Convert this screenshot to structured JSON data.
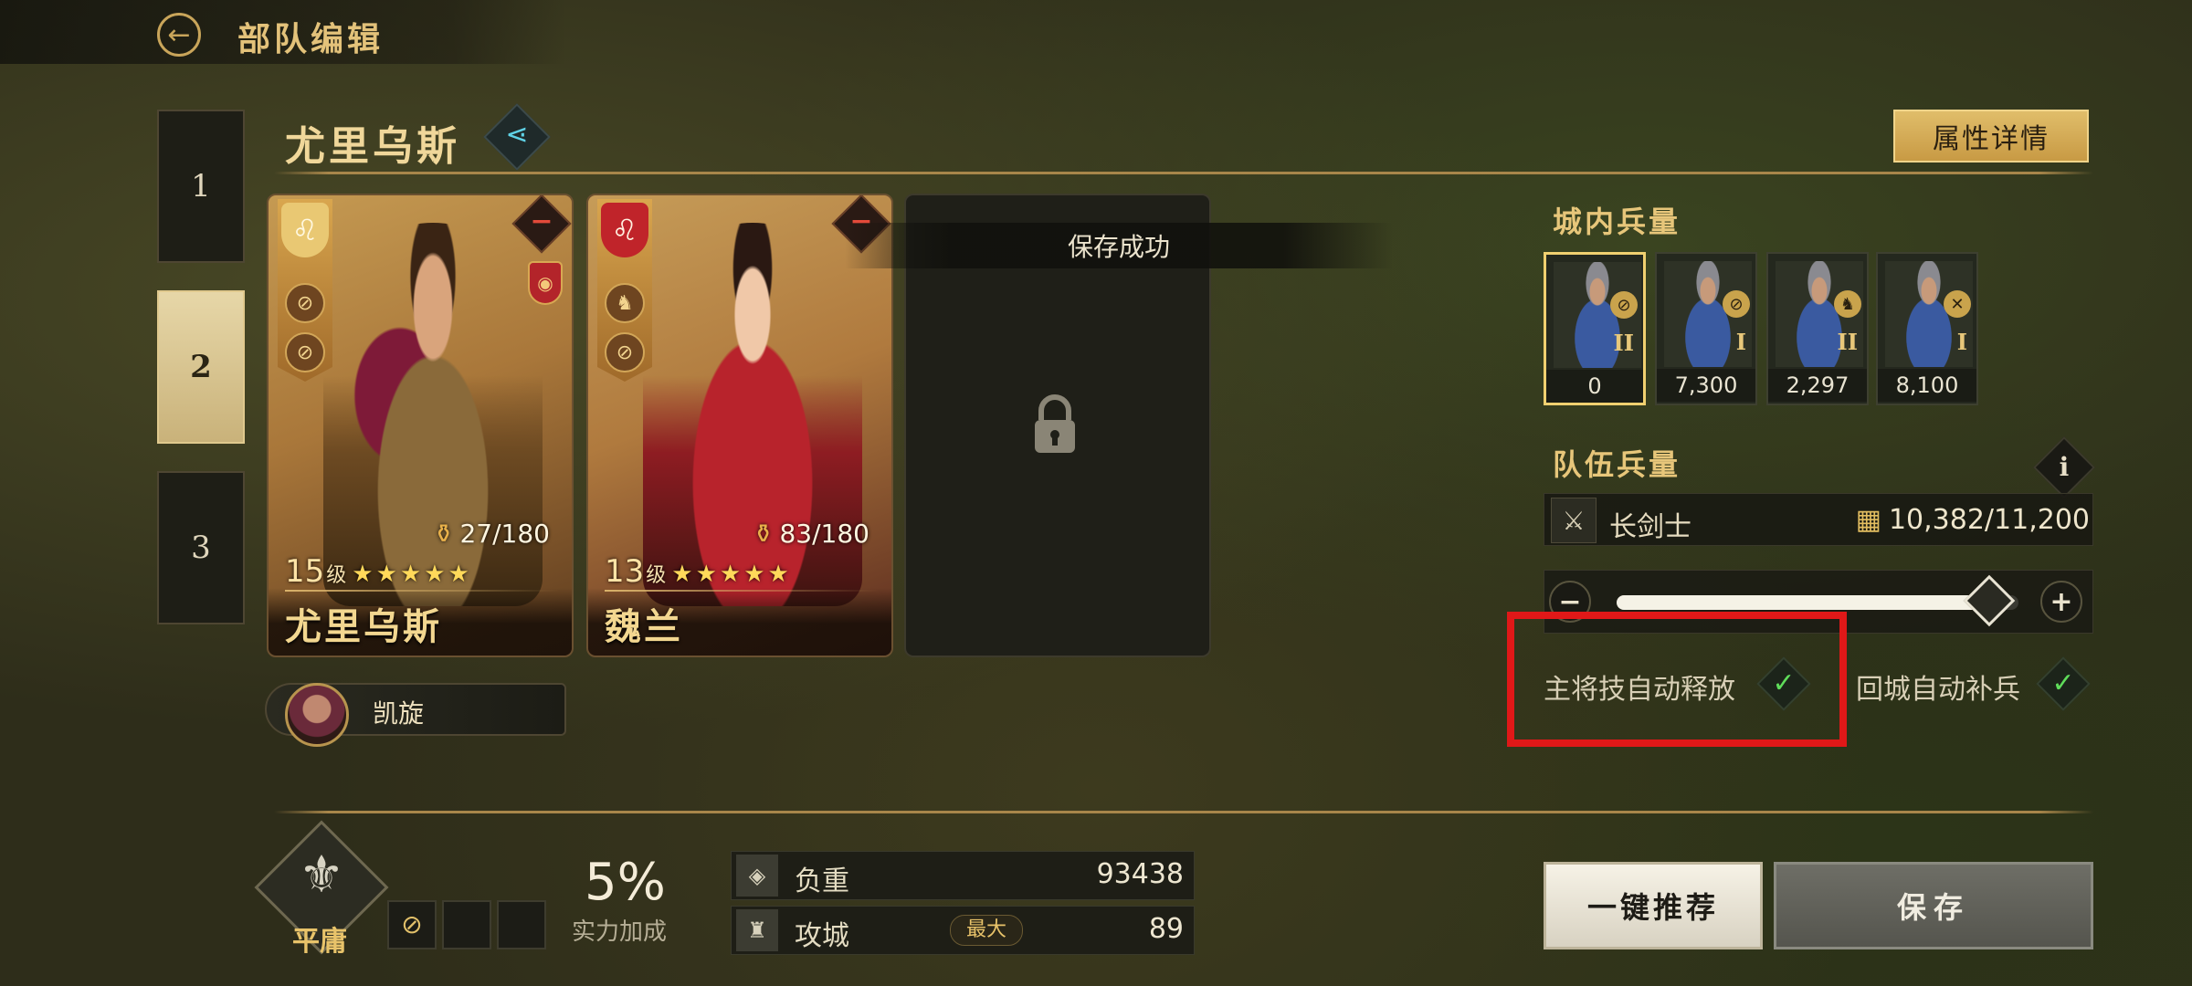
{
  "header": {
    "title": "部队编辑",
    "back_icon": "back-arrow-icon"
  },
  "slots": [
    {
      "label": "1",
      "active": false
    },
    {
      "label": "2",
      "active": true
    },
    {
      "label": "3",
      "active": false
    }
  ],
  "commander": {
    "name": "尤里乌斯",
    "share_icon": "share-icon"
  },
  "attr_button": "属性详情",
  "toast": "保存成功",
  "heroes": [
    {
      "name": "尤里乌斯",
      "level": "15",
      "level_unit": "级",
      "stars": "★★★★★",
      "power": "27/180",
      "power_current": 27,
      "power_max": 180
    },
    {
      "name": "魏兰",
      "level": "13",
      "level_unit": "级",
      "stars": "★★★★★",
      "power": "83/180",
      "power_current": 83,
      "power_max": 180
    }
  ],
  "skill": {
    "name": "凯旋"
  },
  "city_troops": {
    "title": "城内兵量",
    "units": [
      {
        "tier": "II",
        "count": "0",
        "selected": true
      },
      {
        "tier": "I",
        "count": "7,300",
        "selected": false
      },
      {
        "tier": "II",
        "count": "2,297",
        "selected": false
      },
      {
        "tier": "I",
        "count": "8,100",
        "selected": false
      }
    ]
  },
  "team_troops": {
    "title": "队伍兵量",
    "unit_name": "长剑士",
    "capacity": "10,382/11,200",
    "slider_fraction": 0.927
  },
  "toggles": {
    "auto_skill": {
      "label": "主将技自动释放",
      "checked": true
    },
    "auto_refill": {
      "label": "回城自动补兵",
      "checked": true
    }
  },
  "formation": {
    "label": "平庸"
  },
  "power": {
    "percent": "5%",
    "label": "实力加成"
  },
  "stats": {
    "load": {
      "label": "负重",
      "value": "93438"
    },
    "siege": {
      "label": "攻城",
      "tag": "最大",
      "value": "89"
    }
  },
  "buttons": {
    "recommend": "一键推荐",
    "save": "保存"
  },
  "colors": {
    "accent_gold": "#e3c27a",
    "highlight_red": "#e01818",
    "check_green": "#5fdc5a"
  }
}
